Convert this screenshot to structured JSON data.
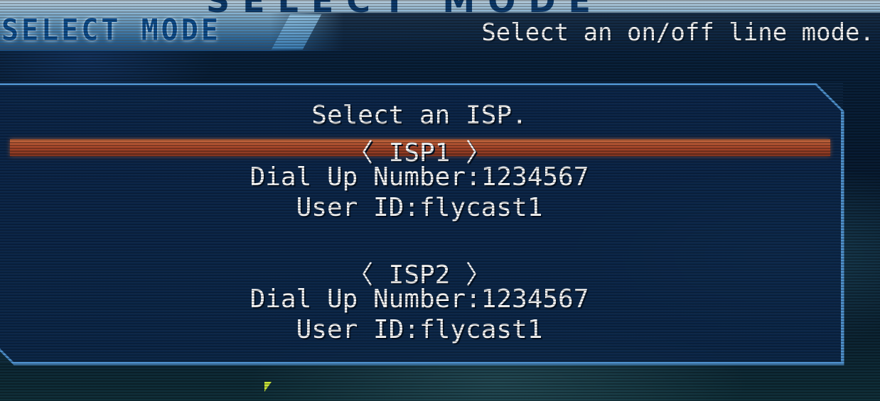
{
  "header": {
    "big_title": "SELECT MODE",
    "logo_title": "SELECT MODE",
    "instruction": "Select an on/off line mode."
  },
  "panel": {
    "prompt": "Select an ISP.",
    "isp_options": [
      {
        "label": "〈 ISP1 〉",
        "dial_up": "Dial Up Number:1234567",
        "user_id": "User ID:flycast1",
        "selected": true
      },
      {
        "label": "〈 ISP2 〉",
        "dial_up": "Dial Up Number:1234567",
        "user_id": "User ID:flycast1",
        "selected": false
      }
    ]
  },
  "colors": {
    "highlight": "#a9472a",
    "panel_border": "#4f93cf",
    "text": "#ffffff"
  },
  "icons": {
    "cursor": "mouse-pointer-icon"
  }
}
